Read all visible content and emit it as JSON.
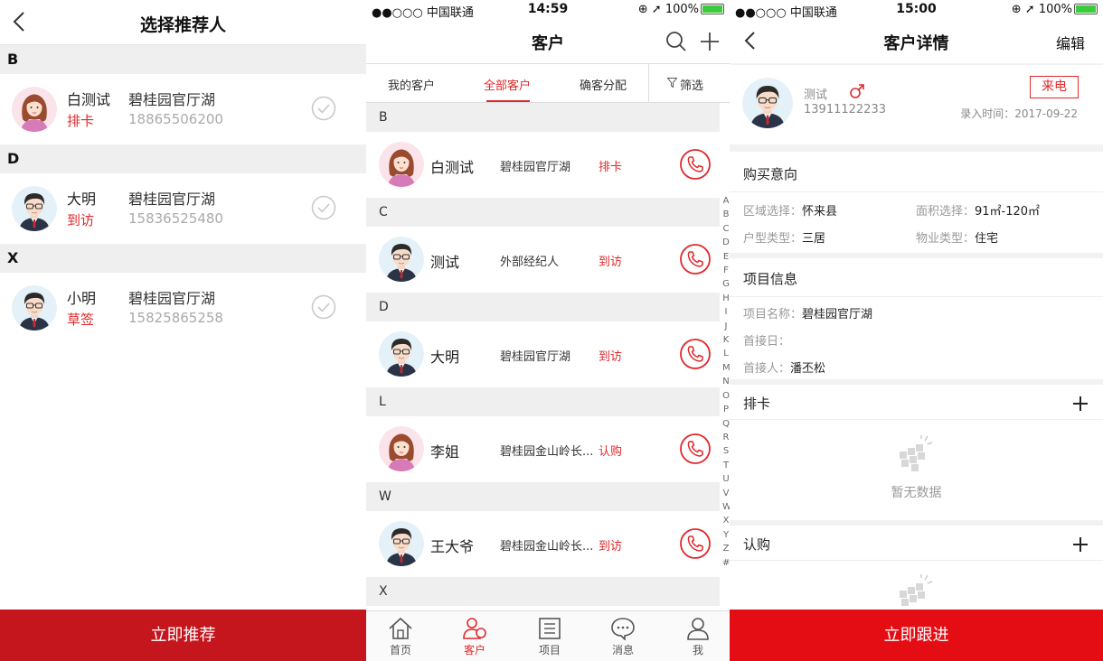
{
  "panel1": {
    "title": "选择推荐人",
    "sections": [
      {
        "letter": "B",
        "rows": [
          {
            "name": "白测试",
            "stage": "排卡",
            "project": "碧桂园官厅湖",
            "phone": "18865506200",
            "avatar": "female"
          }
        ]
      },
      {
        "letter": "D",
        "rows": [
          {
            "name": "大明",
            "stage": "到访",
            "project": "碧桂园官厅湖",
            "phone": "15836525480",
            "avatar": "male"
          }
        ]
      },
      {
        "letter": "X",
        "rows": [
          {
            "name": "小明",
            "stage": "草签",
            "project": "碧桂园官厅湖",
            "phone": "15825865258",
            "avatar": "male"
          }
        ]
      }
    ],
    "bottom_button": "立即推荐"
  },
  "panel2": {
    "status": {
      "carrier": "●●○○○ 中国联通",
      "time": "14:59",
      "battery": "100%"
    },
    "title": "客户",
    "tabs": [
      "我的客户",
      "全部客户",
      "确客分配"
    ],
    "active_tab": "全部客户",
    "filter_label": "筛选",
    "sections": [
      "B",
      "C",
      "D",
      "L",
      "W",
      "X"
    ],
    "rows": [
      {
        "name": "白测试",
        "project": "碧桂园官厅湖",
        "stage": "排卡"
      },
      {
        "name": "测试",
        "project": "外部经纪人",
        "stage": "到访"
      },
      {
        "name": "大明",
        "project": "碧桂园官厅湖",
        "stage": "到访"
      },
      {
        "name": "李姐",
        "project": "碧桂园金山岭长...",
        "stage": "认购"
      },
      {
        "name": "王大爷",
        "project": "碧桂园金山岭长...",
        "stage": "到访"
      }
    ],
    "alphabet": [
      "A",
      "B",
      "C",
      "D",
      "E",
      "F",
      "G",
      "H",
      "I",
      "J",
      "K",
      "L",
      "M",
      "N",
      "O",
      "P",
      "Q",
      "R",
      "S",
      "T",
      "U",
      "V",
      "W",
      "X",
      "Y",
      "Z",
      "#"
    ],
    "tabbar": [
      "首页",
      "客户",
      "项目",
      "消息",
      "我"
    ],
    "active_tabbar": "客户"
  },
  "panel3": {
    "status": {
      "carrier": "●●○○○ 中国联通",
      "time": "15:00",
      "battery": "100%"
    },
    "title": "客户详情",
    "edit": "编辑",
    "profile": {
      "name": "测试",
      "phone": "13911122233",
      "badge": "来电",
      "entry_label": "录入时间：",
      "entry_date": "2017-09-22"
    },
    "intent": {
      "title": "购买意向",
      "region_label": "区域选择：",
      "region": "怀来县",
      "area_label": "面积选择：",
      "area": "91㎡-120㎡",
      "layout_label": "户型类型：",
      "layout": "三居",
      "property_label": "物业类型：",
      "property": "住宅"
    },
    "project": {
      "title": "项目信息",
      "name_label": "项目名称：",
      "name": "碧桂园官厅湖",
      "first_day_label": "首接日：",
      "first_person_label": "首接人：",
      "first_person": "潘丕松"
    },
    "paika": {
      "title": "排卡",
      "empty": "暂无数据"
    },
    "rengou": {
      "title": "认购"
    },
    "bottom_button": "立即跟进"
  },
  "colors": {
    "accent": "#e0282b",
    "bottom_dark": "#c4161c",
    "bottom_bright": "#e50d14"
  }
}
